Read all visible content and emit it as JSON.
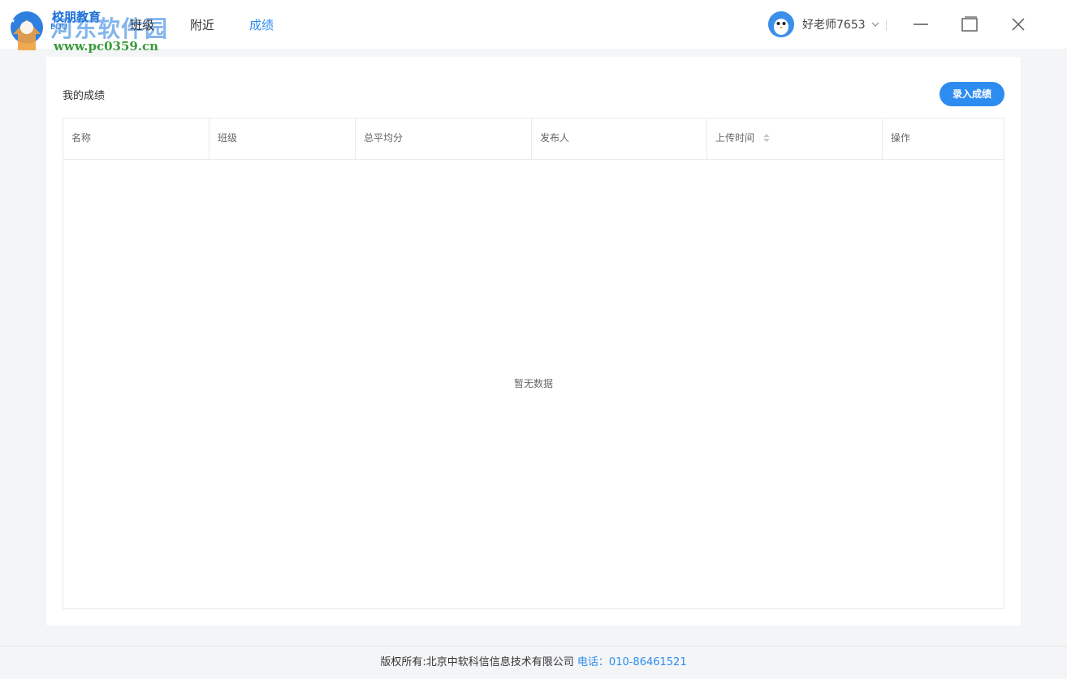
{
  "logo": {
    "name_cn": "校朋教育",
    "name_en": "EDU"
  },
  "watermark": {
    "site_name": "河东软件园",
    "url": "www.pc0359.cn"
  },
  "nav": {
    "items": [
      {
        "label": "班级",
        "active": false
      },
      {
        "label": "附近",
        "active": false
      },
      {
        "label": "成绩",
        "active": true
      }
    ]
  },
  "user": {
    "name": "好老师7653",
    "avatar_icon": "penguin-avatar-icon"
  },
  "window_controls": [
    "minimize-icon",
    "maximize-icon",
    "close-icon"
  ],
  "main": {
    "title": "我的成绩",
    "add_button_label": "录入成绩",
    "table": {
      "columns": [
        {
          "label": "名称",
          "sortable": false
        },
        {
          "label": "班级",
          "sortable": false
        },
        {
          "label": "总平均分",
          "sortable": false
        },
        {
          "label": "发布人",
          "sortable": false
        },
        {
          "label": "上传时间",
          "sortable": true
        },
        {
          "label": "操作",
          "sortable": false
        }
      ],
      "rows": [],
      "empty_text": "暂无数据"
    }
  },
  "footer": {
    "copyright": "版权所有:北京中软科信信息技术有限公司",
    "phone": "电话：010-86461521"
  },
  "colors": {
    "accent": "#2d8cf0",
    "background": "#f4f5f7",
    "watermark_green": "#3a9a3a"
  }
}
